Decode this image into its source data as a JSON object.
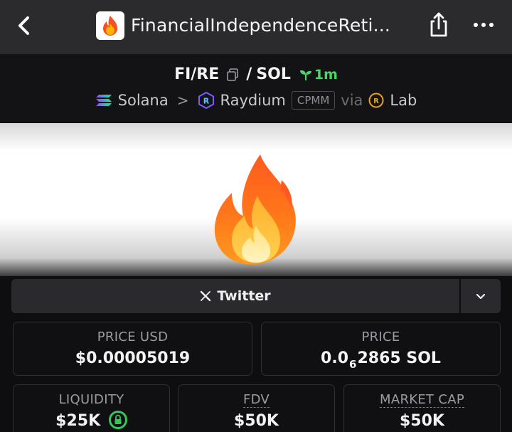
{
  "topbar": {
    "site_title": "FinancialIndependenceReti..."
  },
  "pair": {
    "base": "FI/RE",
    "separator": "/",
    "quote": "SOL",
    "age": "1m"
  },
  "route": {
    "chain": "Solana",
    "arrow": ">",
    "dex": "Raydium",
    "pool_type": "CPMM",
    "via": "via",
    "launchpad": "Lab"
  },
  "links": {
    "twitter_label": "Twitter"
  },
  "stats": {
    "price_usd_label": "PRICE USD",
    "price_usd_value": "$0.00005019",
    "price_label": "PRICE",
    "price_prefix": "0.0",
    "price_zero_count": "6",
    "price_suffix": "2865 SOL",
    "liquidity_label": "LIQUIDITY",
    "liquidity_value": "$25K",
    "fdv_label": "FDV",
    "fdv_value": "$50K",
    "mcap_label": "MARKET CAP",
    "mcap_value": "$50K"
  },
  "colors": {
    "accent_green": "#4cd46a",
    "background": "#0e0e10"
  },
  "icons": {
    "back": "chevron-left-icon",
    "site": "fire-emoji-icon",
    "share": "share-icon",
    "more": "more-horizontal-icon",
    "copy": "copy-icon",
    "age": "sprout-icon",
    "chain": "solana-icon",
    "dex": "raydium-icon",
    "launchpad": "raydium-lab-icon",
    "twitter": "x-logo-icon",
    "dropdown": "chevron-down-icon",
    "lock": "lock-icon",
    "banner": "fire-emoji-image"
  }
}
